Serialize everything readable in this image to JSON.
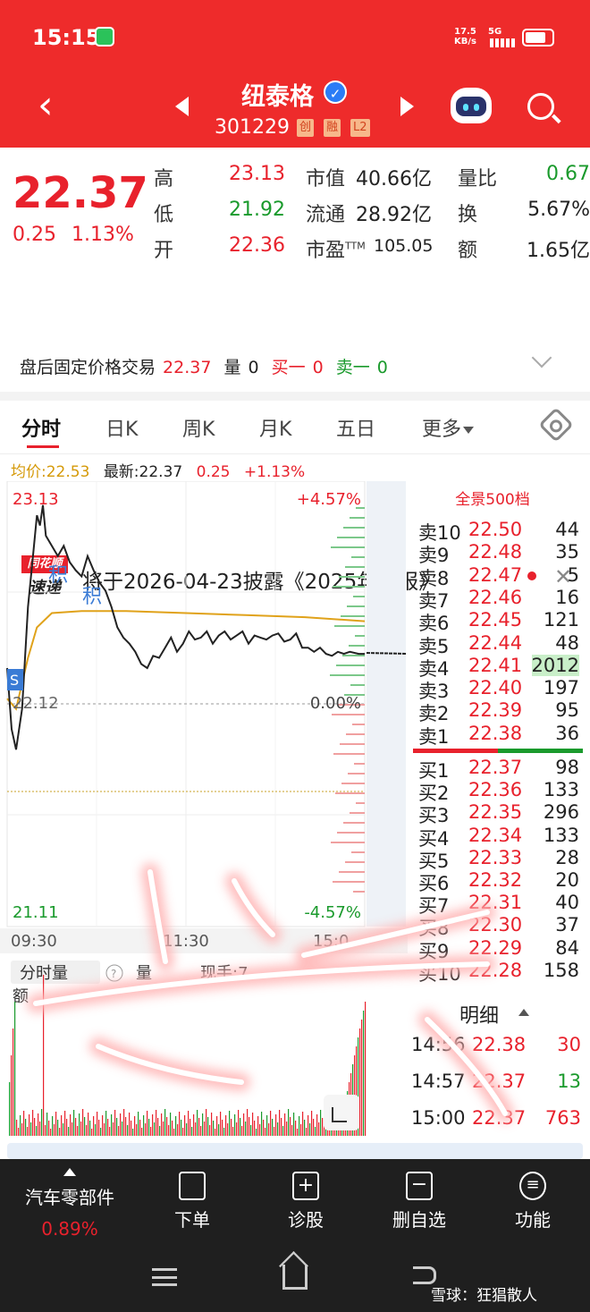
{
  "status_bar": {
    "time": "15:15",
    "net_speed": "17.5",
    "net_unit": "KB/s",
    "signal": "5G",
    "wechat_icon": "wechat-icon"
  },
  "header": {
    "stock_name": "纽泰格",
    "code": "301229",
    "tags": [
      "创",
      "融",
      "L2"
    ]
  },
  "quote": {
    "price": "22.37",
    "change": "0.25",
    "change_pct": "1.13%",
    "high_label": "高",
    "high": "23.13",
    "low_label": "低",
    "low": "21.92",
    "open_label": "开",
    "open": "22.36",
    "mktcap_label": "市值",
    "mktcap": "40.66亿",
    "float_label": "流通",
    "float": "28.92亿",
    "pe_label": "市盈",
    "pe_sup": "TTM",
    "pe": "105.05",
    "volratio_label": "量比",
    "volratio": "0.67",
    "turnover_label": "换",
    "turnover": "5.67%",
    "amount_label": "额",
    "amount": "1.65亿"
  },
  "notice": {
    "logo_top": "同花顺",
    "logo_bottom": "速递",
    "text": "将于2026-04-23披露《2025年年报》"
  },
  "after_hours": {
    "label": "盘后固定价格交易",
    "price": "22.37",
    "vol_label": "量",
    "vol": "0",
    "buy1_label": "买一",
    "buy1": "0",
    "sell1_label": "卖一",
    "sell1": "0"
  },
  "tabs": [
    "分时",
    "日K",
    "周K",
    "月K",
    "五日",
    "更多"
  ],
  "infobar": {
    "avg_label": "均价:22.53",
    "latest_label": "最新:22.37",
    "chg": "0.25",
    "chg_pct": "+1.13%"
  },
  "chart_labels": {
    "top_price": "23.13",
    "top_pct": "+4.57%",
    "mid_price": "22.12",
    "mid_pct": "0.00%",
    "bot_price": "21.11",
    "bot_pct": "-4.57%",
    "t_start": "09:30",
    "t_mid": "11:30",
    "t_end": "15:0",
    "marker_s": "S",
    "marker_ji": "积",
    "vol_tab": "分时量",
    "vol_label": "量",
    "vol_turn": "现手:7",
    "amount_label": "额"
  },
  "chart_data": {
    "type": "line",
    "ylim": [
      21.11,
      23.13
    ],
    "x_end": 240,
    "series": [
      {
        "values": [
          [
            0,
            22.3
          ],
          [
            3,
            22.0
          ],
          [
            6,
            21.9
          ],
          [
            10,
            22.1
          ],
          [
            14,
            22.6
          ],
          [
            18,
            22.9
          ],
          [
            20,
            23.05
          ],
          [
            22,
            23.0
          ],
          [
            24,
            23.1
          ],
          [
            26,
            22.95
          ],
          [
            30,
            22.9
          ],
          [
            34,
            22.85
          ],
          [
            38,
            22.9
          ],
          [
            42,
            22.82
          ],
          [
            46,
            22.78
          ],
          [
            50,
            22.75
          ],
          [
            54,
            22.85
          ],
          [
            58,
            22.78
          ],
          [
            62,
            22.72
          ],
          [
            66,
            22.68
          ],
          [
            70,
            22.6
          ],
          [
            74,
            22.5
          ],
          [
            78,
            22.45
          ],
          [
            82,
            22.42
          ],
          [
            86,
            22.38
          ],
          [
            90,
            22.32
          ],
          [
            94,
            22.3
          ],
          [
            98,
            22.36
          ],
          [
            102,
            22.35
          ],
          [
            106,
            22.4
          ],
          [
            110,
            22.45
          ],
          [
            114,
            22.38
          ],
          [
            118,
            22.42
          ],
          [
            122,
            22.48
          ],
          [
            126,
            22.44
          ],
          [
            130,
            22.45
          ],
          [
            134,
            22.48
          ],
          [
            138,
            22.42
          ],
          [
            142,
            22.46
          ],
          [
            146,
            22.48
          ],
          [
            150,
            22.44
          ],
          [
            154,
            22.46
          ],
          [
            158,
            22.48
          ],
          [
            162,
            22.42
          ],
          [
            166,
            22.46
          ],
          [
            170,
            22.45
          ],
          [
            174,
            22.44
          ],
          [
            178,
            22.46
          ],
          [
            182,
            22.47
          ],
          [
            186,
            22.43
          ],
          [
            190,
            22.44
          ],
          [
            194,
            22.47
          ],
          [
            198,
            22.4
          ],
          [
            202,
            22.4
          ],
          [
            206,
            22.38
          ],
          [
            210,
            22.4
          ],
          [
            214,
            22.37
          ],
          [
            218,
            22.36
          ],
          [
            222,
            22.38
          ],
          [
            226,
            22.37
          ],
          [
            230,
            22.38
          ],
          [
            236,
            22.37
          ],
          [
            240,
            22.37
          ]
        ]
      },
      {
        "values": [
          [
            0,
            22.15
          ],
          [
            6,
            22.1
          ],
          [
            14,
            22.35
          ],
          [
            20,
            22.5
          ],
          [
            30,
            22.57
          ],
          [
            50,
            22.58
          ],
          [
            80,
            22.58
          ],
          [
            120,
            22.57
          ],
          [
            160,
            22.56
          ],
          [
            200,
            22.55
          ],
          [
            240,
            22.53
          ]
        ]
      }
    ]
  },
  "orderbook": {
    "title": "全景500档",
    "asks": [
      {
        "l": "卖10",
        "p": "22.50",
        "v": "44"
      },
      {
        "l": "卖9",
        "p": "22.48",
        "v": "35"
      },
      {
        "l": "卖8",
        "p": "22.47",
        "v": "5"
      },
      {
        "l": "卖7",
        "p": "22.46",
        "v": "16"
      },
      {
        "l": "卖6",
        "p": "22.45",
        "v": "121"
      },
      {
        "l": "卖5",
        "p": "22.44",
        "v": "48"
      },
      {
        "l": "卖4",
        "p": "22.41",
        "v": "2012"
      },
      {
        "l": "卖3",
        "p": "22.40",
        "v": "197"
      },
      {
        "l": "卖2",
        "p": "22.39",
        "v": "95"
      },
      {
        "l": "卖1",
        "p": "22.38",
        "v": "36"
      }
    ],
    "bids": [
      {
        "l": "买1",
        "p": "22.37",
        "v": "98"
      },
      {
        "l": "买2",
        "p": "22.36",
        "v": "133"
      },
      {
        "l": "买3",
        "p": "22.35",
        "v": "296"
      },
      {
        "l": "买4",
        "p": "22.34",
        "v": "133"
      },
      {
        "l": "买5",
        "p": "22.33",
        "v": "28"
      },
      {
        "l": "买6",
        "p": "22.32",
        "v": "20"
      },
      {
        "l": "买7",
        "p": "22.31",
        "v": "40"
      },
      {
        "l": "买8",
        "p": "22.30",
        "v": "37"
      },
      {
        "l": "买9",
        "p": "22.29",
        "v": "84"
      },
      {
        "l": "买10",
        "p": "22.28",
        "v": "158"
      }
    ]
  },
  "detail": {
    "title": "明细",
    "rows": [
      {
        "t": "14:56",
        "p": "22.38",
        "v": "30"
      },
      {
        "t": "14:57",
        "p": "22.37",
        "v": "13"
      },
      {
        "t": "15:00",
        "p": "22.37",
        "v": "763"
      }
    ]
  },
  "bottom_nav": {
    "sector_name": "汽车零部件",
    "sector_pct": "0.89%",
    "items": [
      "下单",
      "诊股",
      "删自选",
      "功能"
    ]
  },
  "watermark": "雪球：狂猖散人"
}
